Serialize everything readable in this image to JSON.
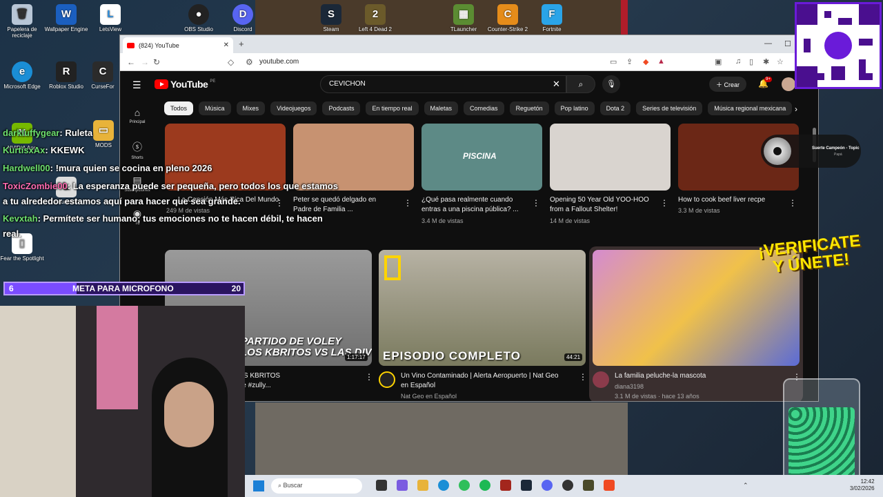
{
  "desktop": {
    "icons": [
      {
        "label": "Papelera de reciclaje",
        "glyph": "🗑"
      },
      {
        "label": "Wallpaper Engine",
        "glyph": "W"
      },
      {
        "label": "LetsView",
        "glyph": "L"
      },
      {
        "label": "OBS Studio",
        "glyph": "●"
      },
      {
        "label": "Discord",
        "glyph": "D"
      },
      {
        "label": "Steam",
        "glyph": "S"
      },
      {
        "label": "Left 4 Dead 2",
        "glyph": "2"
      },
      {
        "label": "TLauncher",
        "glyph": "▦"
      },
      {
        "label": "Counter-Strike 2",
        "glyph": "C"
      },
      {
        "label": "Fortnite",
        "glyph": "F"
      },
      {
        "label": "Microsoft Edge",
        "glyph": "e"
      },
      {
        "label": "Roblox Studio",
        "glyph": "R"
      },
      {
        "label": "CurseFor",
        "glyph": "C"
      },
      {
        "label": "NVIDIA App",
        "glyph": "N"
      },
      {
        "label": "MODS",
        "glyph": "▭"
      },
      {
        "label": "Launcher",
        "glyph": "L"
      },
      {
        "label": "Fear the Spotlight",
        "glyph": "▯"
      }
    ]
  },
  "browser": {
    "tab_title": "(824) YouTube",
    "url": "youtube.com"
  },
  "youtube": {
    "logo": "YouTube",
    "region": "PE",
    "search_value": "CEVICHON",
    "create_label": "Crear",
    "notif_count": "9+",
    "sidebar": [
      "Principal",
      "Shorts",
      "Suscripciones",
      "Tú"
    ],
    "chips": [
      "Todos",
      "Música",
      "Mixes",
      "Videojuegos",
      "Podcasts",
      "En tiempo real",
      "Maletas",
      "Comedias",
      "Reguetón",
      "Pop latino",
      "Dota 2",
      "Series de televisión",
      "Música regional mexicana"
    ],
    "row1": [
      {
        "title": "La Canción Más Rica Del Mundo",
        "title2": "",
        "meta": "249 M de vistas",
        "thumb": "#9c3a1e"
      },
      {
        "title": "Peter se quedó delgado en",
        "title2": "Padre de Familia ...",
        "meta": "",
        "thumb": "#c79271"
      },
      {
        "title": "¿Qué pasa realmente cuando",
        "title2": "entras a una piscina pública? ...",
        "meta": "3.4 M de vistas",
        "thumb": "#5d8a86",
        "overlay": "PISCINA"
      },
      {
        "title": "Opening 50 Year Old YOO-HOO",
        "title2": "from a Fallout Shelter!",
        "meta": "14 M de vistas",
        "thumb": "#d9d4cf"
      },
      {
        "title": "How to cook beef liver recpe",
        "title2": "",
        "meta": "3.3 M de vistas",
        "thumb": "#6b2716"
      }
    ],
    "row2": [
      {
        "title": "LOS STREAMERS vs LOS KBRITOS",
        "title2": "#danielataquire #macbride #zully...",
        "channel": "",
        "meta": "",
        "duration": "1:17:17",
        "overlay": "PARTIDO DE VOLEY\nLOS KBRITOS VS LAS DIVINAS"
      },
      {
        "title": "Un Vino Contaminado | Alerta Aeropuerto | Nat Geo",
        "title2": "en Español",
        "channel": "Nat Geo en Español",
        "meta": "",
        "duration": "44:21",
        "overlay": "EPISODIO COMPLETO"
      },
      {
        "title": "La familia peluche-la mascota",
        "title2": "",
        "channel": "diana3198",
        "meta": "3.1 M de vistas · hace 13 años",
        "duration": "",
        "overlay": ""
      }
    ]
  },
  "chat": [
    {
      "user": "darkluffygear",
      "msg": ": Ruleta"
    },
    {
      "user": "KurtisxAx",
      "msg": ": KKEWK"
    },
    {
      "user": "Hardwell00",
      "msg": ": !mura quien se cocina en pleno 2026"
    },
    {
      "user": "ToxicZombie00",
      "msg": ": La esperanza puede ser pequeña, pero todos los que estamos"
    },
    {
      "user": "",
      "msg": "a tu alrededor estamos aquí para hacer que sea grande."
    },
    {
      "user": "Kevxtah",
      "msg": ": Permítete ser humano; tus emociones no te hacen débil, te hacen"
    },
    {
      "user": "",
      "msg": "real."
    }
  ],
  "goal": {
    "current": "6",
    "label": "META PARA MICROFONO",
    "target": "20",
    "progress": 0.3
  },
  "now_playing": {
    "title": "Suerte Campeón - Topic",
    "artist": "Papá"
  },
  "promo": {
    "line1": "¡VERIFICATE",
    "line2": "Y ÚNETE!"
  },
  "taskbar": {
    "search_placeholder": "Buscar",
    "time": "12:42",
    "date": "3/02/2026"
  },
  "colors": {
    "youtube_red": "#ff0000",
    "chat_user": "#6ee06e",
    "promo": "#ffe600"
  }
}
